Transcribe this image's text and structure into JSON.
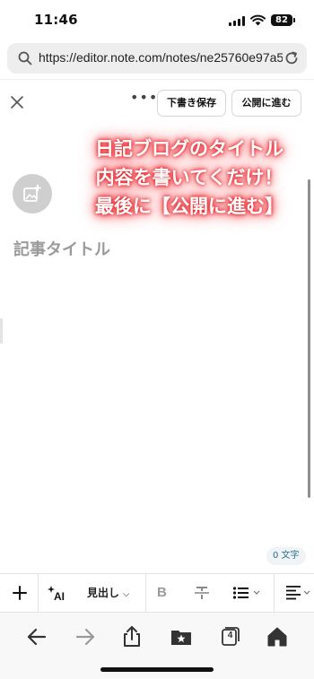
{
  "status_bar": {
    "time": "11:46",
    "battery": "82"
  },
  "url_bar": {
    "url": "https://editor.note.com/notes/ne25760e97a5..."
  },
  "editor_header": {
    "more_label": "•••",
    "draft_button": "下書き保存",
    "publish_button": "公開に進む"
  },
  "overlay_caption": {
    "lines": [
      "日記ブログのタイトル",
      "内容を書いてくだけ！",
      "最後に【公開に進む】"
    ]
  },
  "editor": {
    "title_placeholder": "記事タイトル",
    "char_count": "0 文字"
  },
  "format_toolbar": {
    "heading_label": "見出し",
    "bold_label": "B"
  },
  "browser_toolbar": {
    "tab_count": "4"
  },
  "icons": {
    "search": "search-icon",
    "reload": "reload-icon",
    "close": "close-icon",
    "add_image": "image-add-icon",
    "ai": "ai-sparkle-icon",
    "strikethrough": "strikethrough-icon",
    "list": "bulleted-list-icon",
    "align": "align-left-icon",
    "back": "back-arrow-icon",
    "forward": "forward-arrow-icon",
    "share": "share-icon",
    "bookmarks": "bookmarks-icon",
    "tabs": "tabs-icon",
    "home": "home-icon"
  },
  "colors": {
    "caption_glow": "#e8262e",
    "char_count_text": "#2a6d8f"
  }
}
